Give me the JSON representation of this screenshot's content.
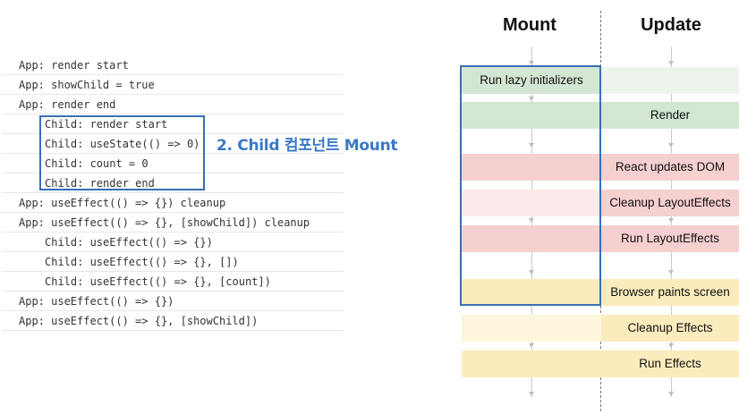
{
  "console": {
    "lines": [
      {
        "indent": 0,
        "text": "App: render start"
      },
      {
        "indent": 0,
        "text": "App: showChild = true"
      },
      {
        "indent": 0,
        "text": "App: render end"
      },
      {
        "indent": 1,
        "text": "Child: render start"
      },
      {
        "indent": 1,
        "text": "Child: useState(() => 0)"
      },
      {
        "indent": 1,
        "text": "Child: count = 0"
      },
      {
        "indent": 1,
        "text": "Child: render end"
      },
      {
        "indent": 0,
        "text": "App: useEffect(() => {}) cleanup"
      },
      {
        "indent": 0,
        "text": "App: useEffect(() => {}, [showChild]) cleanup"
      },
      {
        "indent": 1,
        "text": "Child: useEffect(() => {})"
      },
      {
        "indent": 1,
        "text": "Child: useEffect(() => {}, [])"
      },
      {
        "indent": 1,
        "text": "Child: useEffect(() => {}, [count])"
      },
      {
        "indent": 0,
        "text": "App: useEffect(() => {})"
      },
      {
        "indent": 0,
        "text": "App: useEffect(() => {}, [showChild])"
      }
    ],
    "callout": "2. Child 컴포넌트 Mount"
  },
  "diagram": {
    "mount_title": "Mount",
    "update_title": "Update",
    "colors": {
      "green": "#d3e6d3",
      "green_light": "#edf4ec",
      "red": "#f6cfcf",
      "red_light": "#fbe8e8",
      "yellow": "#fbecbd",
      "yellow_light": "#fdf6dd",
      "highlight_border": "#3a6fb5"
    },
    "stages": [
      {
        "mount": "Run lazy initializers",
        "update": ""
      },
      {
        "mount": "",
        "update": "Render"
      },
      {
        "mount": "",
        "update": "React updates DOM"
      },
      {
        "mount": "",
        "update": "Cleanup LayoutEffects"
      },
      {
        "mount": "",
        "update": "Run LayoutEffects"
      },
      {
        "mount": "",
        "update": "Browser paints screen"
      },
      {
        "mount": "",
        "update": "Cleanup Effects"
      },
      {
        "mount": "",
        "update": "Run Effects"
      }
    ]
  }
}
